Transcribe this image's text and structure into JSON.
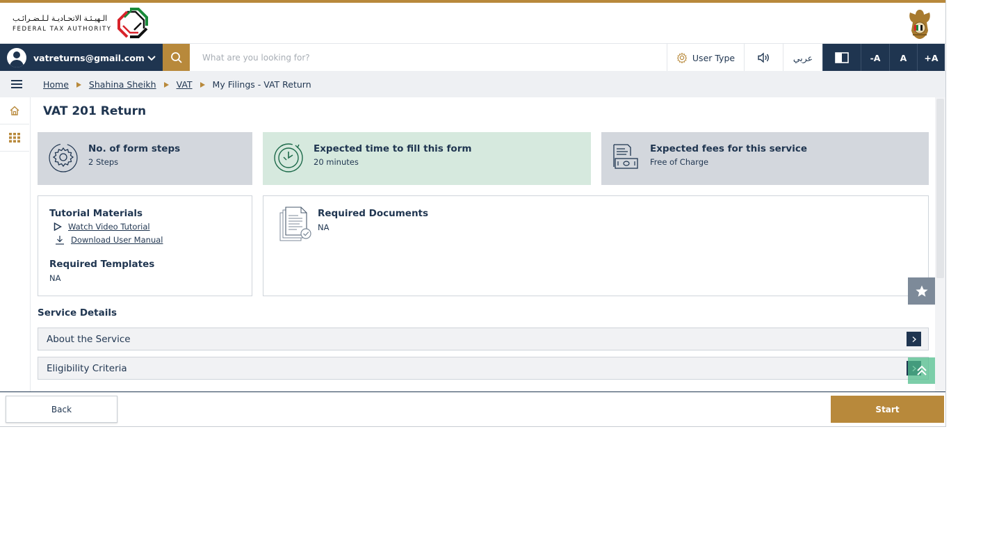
{
  "header": {
    "logo_arabic": "الـهيـئـة الاتحـاديـة لـلـضـرائـب",
    "logo_english": "FEDERAL TAX AUTHORITY"
  },
  "nav": {
    "user_email": "vatreturns@gmail.com",
    "search_placeholder": "What are you looking for?",
    "user_type_label": "User Type",
    "language_label": "عربي",
    "font_decrease_label": "-A",
    "font_reset_label": "A",
    "font_increase_label": "+A"
  },
  "breadcrumb": [
    "Home",
    "Shahina Sheikh",
    "VAT",
    "My Filings - VAT Return"
  ],
  "page": {
    "title": "VAT 201 Return"
  },
  "info_cards": [
    {
      "title": "No. of form steps",
      "value": "2 Steps",
      "icon": "gear-steps-icon",
      "bg": "#d3d7dd"
    },
    {
      "title": "Expected time to fill this form",
      "value": "20 minutes",
      "icon": "clock-icon",
      "bg": "#d6e9de"
    },
    {
      "title": "Expected fees for this service",
      "value": "Free of Charge",
      "icon": "invoice-cash-icon",
      "bg": "#d3d7dd"
    }
  ],
  "tutorial": {
    "title": "Tutorial Materials",
    "video_link": "Watch Video Tutorial",
    "manual_link": "Download User Manual",
    "templates_title": "Required Templates",
    "templates_value": "NA"
  },
  "documents": {
    "title": "Required Documents",
    "value": "NA"
  },
  "service_details": {
    "heading": "Service Details",
    "sections": [
      "About the Service",
      "Eligibility Criteria"
    ]
  },
  "footer": {
    "back_label": "Back",
    "start_label": "Start"
  },
  "colors": {
    "navy": "#1f3550",
    "gold": "#b8893b",
    "green_card": "#d6e9de",
    "gray_card": "#d3d7dd"
  }
}
